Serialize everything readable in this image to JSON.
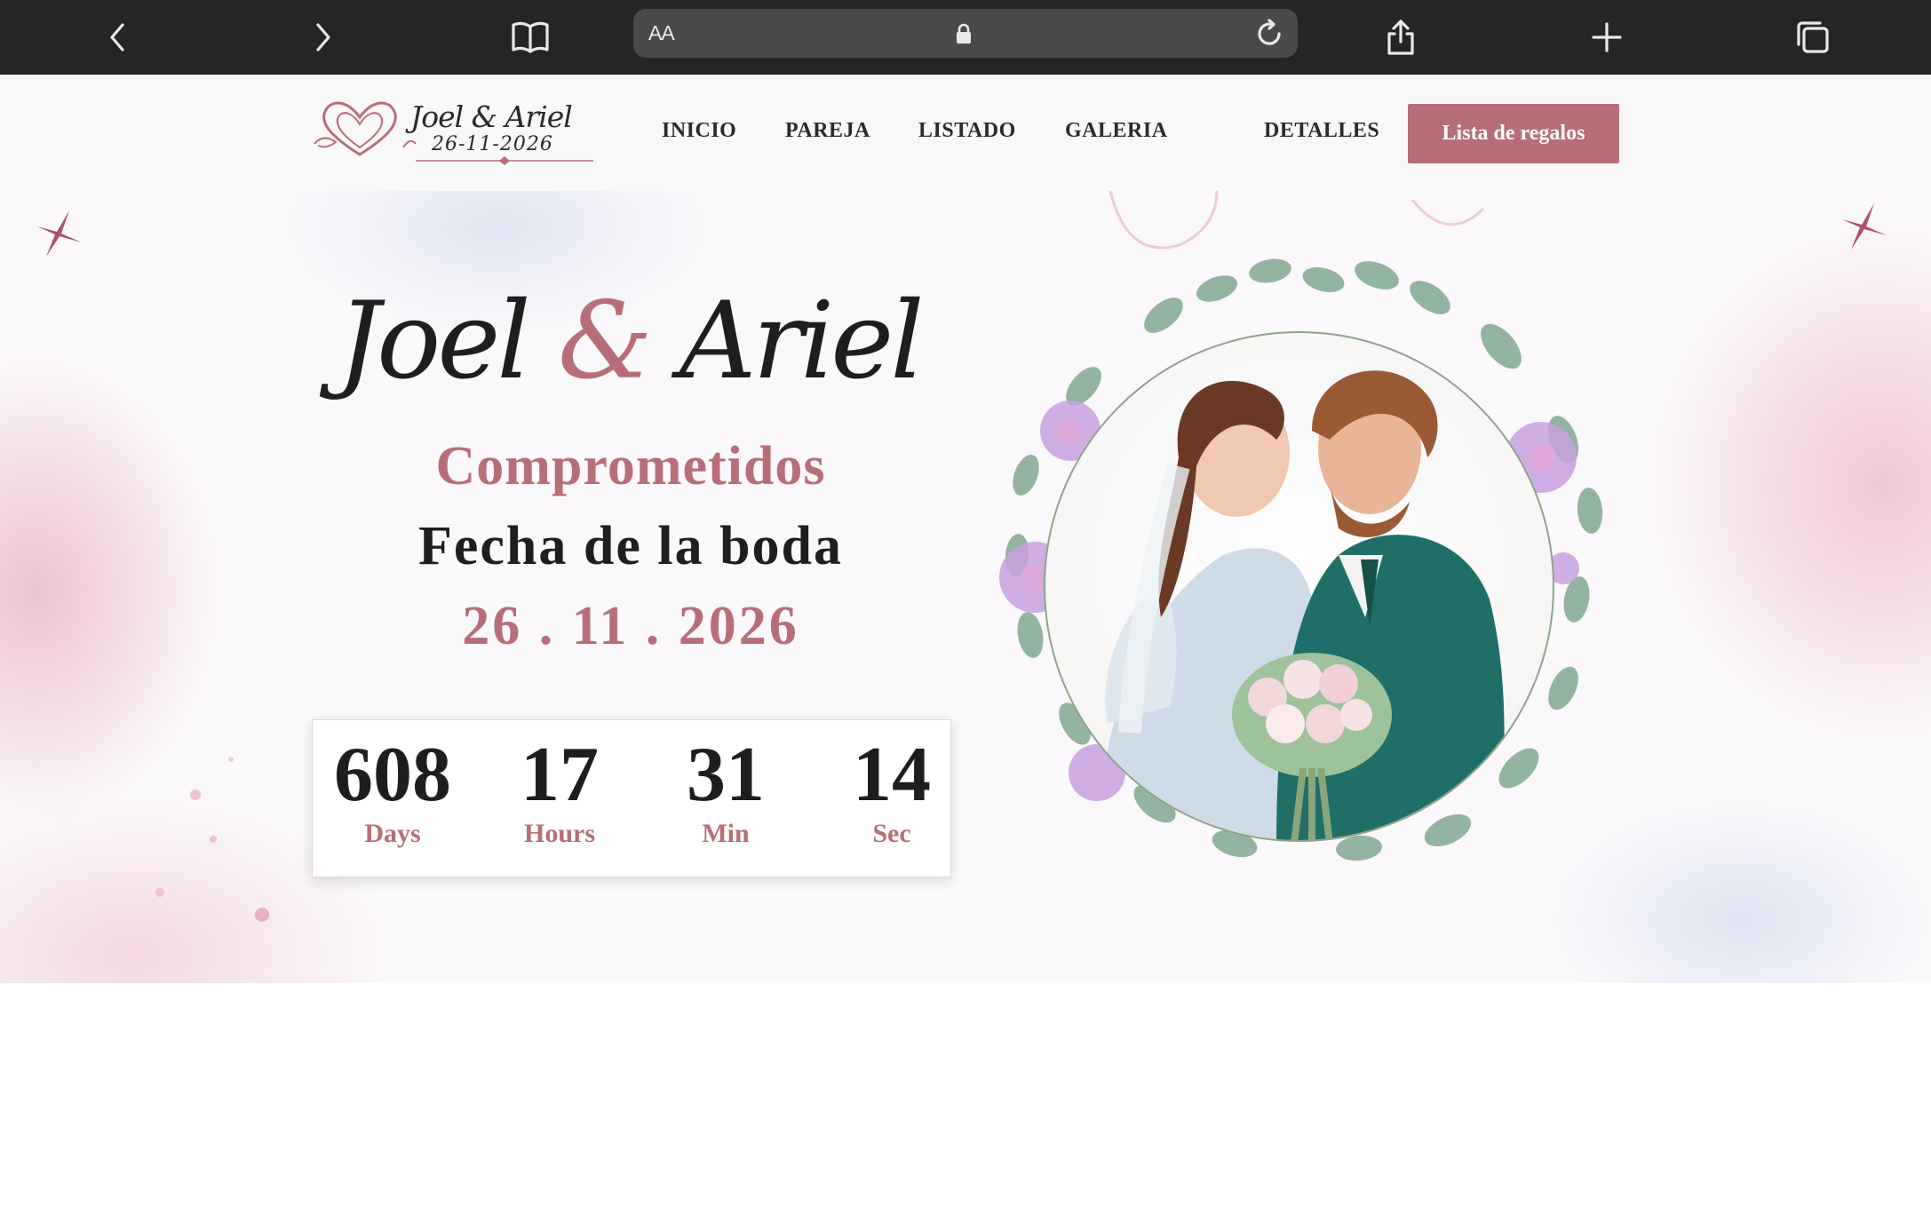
{
  "browser": {
    "url_text": "AA",
    "icons": [
      "chevron-left-icon",
      "chevron-right-icon",
      "book-icon",
      "lock-icon",
      "reload-icon",
      "share-icon",
      "plus-icon",
      "tabs-icon"
    ]
  },
  "logo": {
    "names": "Joel & Ariel",
    "date": "26-11-2026"
  },
  "nav": {
    "items": [
      "INICIO",
      "PAREJA",
      "LISTADO",
      "GALERIA",
      "DETALLES"
    ],
    "cta_label": "Lista de regalos"
  },
  "hero": {
    "name1": "Joel",
    "ampersand": "&",
    "name2": "Ariel",
    "status": "Comprometidos",
    "date_label": "Fecha de la boda",
    "date_value": "26 . 11 . 2026",
    "countdown": [
      {
        "value": "608",
        "unit": "Days"
      },
      {
        "value": "17",
        "unit": "Hours"
      },
      {
        "value": "31",
        "unit": "Min"
      },
      {
        "value": "14",
        "unit": "Sec"
      }
    ]
  },
  "colors": {
    "accent": "#b76e79",
    "text": "#1e1e1e",
    "chrome": "#252525"
  }
}
